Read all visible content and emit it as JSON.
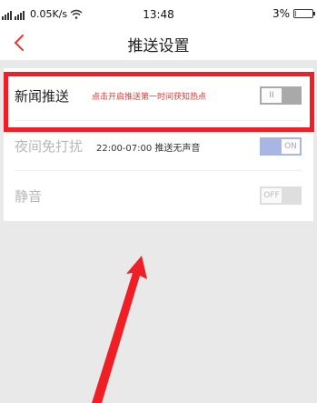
{
  "status_bar": {
    "left_text": "0.05K/s",
    "time": "13:48",
    "battery_percent": "3%",
    "battery_level": 0.03
  },
  "nav": {
    "title": "推送设置"
  },
  "settings": [
    {
      "label": "新闻推送",
      "description": "点击开启推送第一时间获知热点",
      "toggle_text": "II",
      "state": "off"
    },
    {
      "label": "夜间免打扰",
      "description": "22:00-07:00 推送无声音",
      "toggle_text": "ON",
      "state": "on"
    },
    {
      "label": "静音",
      "description": "",
      "toggle_text": "OFF",
      "state": "off"
    }
  ],
  "colors": {
    "accent_red": "#f01f25",
    "toggle_on": "#a7b6e2",
    "toggle_off_dark": "#a9a9a9",
    "toggle_off_light": "#dedede"
  }
}
